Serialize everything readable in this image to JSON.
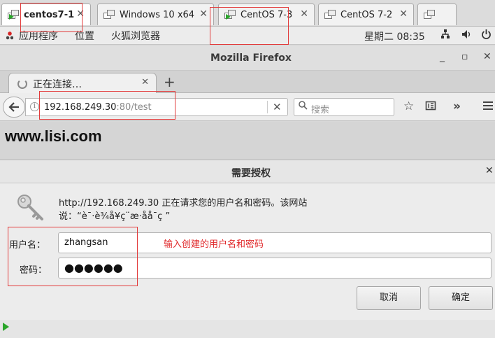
{
  "vm_tabs": [
    {
      "label": "centos7-1",
      "active": true,
      "running": true
    },
    {
      "label": "Windows 10 x64",
      "active": false,
      "running": false
    },
    {
      "label": "CentOS 7-3",
      "active": false,
      "running": true
    },
    {
      "label": "CentOS 7-2",
      "active": false,
      "running": false
    },
    {
      "label": "",
      "active": false,
      "running": false
    }
  ],
  "gnome": {
    "apps_menu": "应用程序",
    "places_menu": "位置",
    "firefox_menu": "火狐浏览器",
    "clock": "星期二 08:35",
    "tray_icons": [
      "network-icon",
      "volume-icon",
      "power-icon"
    ]
  },
  "firefox": {
    "window_title": "Mozilla Firefox",
    "tab": {
      "label": "正在连接…"
    },
    "url": {
      "host": "192.168.249.30",
      "rest": ":80/test"
    },
    "search_placeholder": "搜索"
  },
  "page": {
    "heading": "www.lisi.com"
  },
  "auth_dialog": {
    "title": "需要授权",
    "message_line1": "http://192.168.249.30 正在请求您的用户名和密码。该网站",
    "message_line2": "说：“è¯·è¾å¥ç¨æ·åå¯ç ”",
    "username_label": "用户名：",
    "username_value": "zhangsan",
    "password_label": "密码：",
    "password_value": "●●●●●●",
    "annotation": "输入创建的用户名和密码",
    "cancel_label": "取消",
    "ok_label": "确定"
  },
  "colors": {
    "highlight": "#e23b3b",
    "annotation": "#e0282a",
    "vm_running": "#2aa52a"
  }
}
